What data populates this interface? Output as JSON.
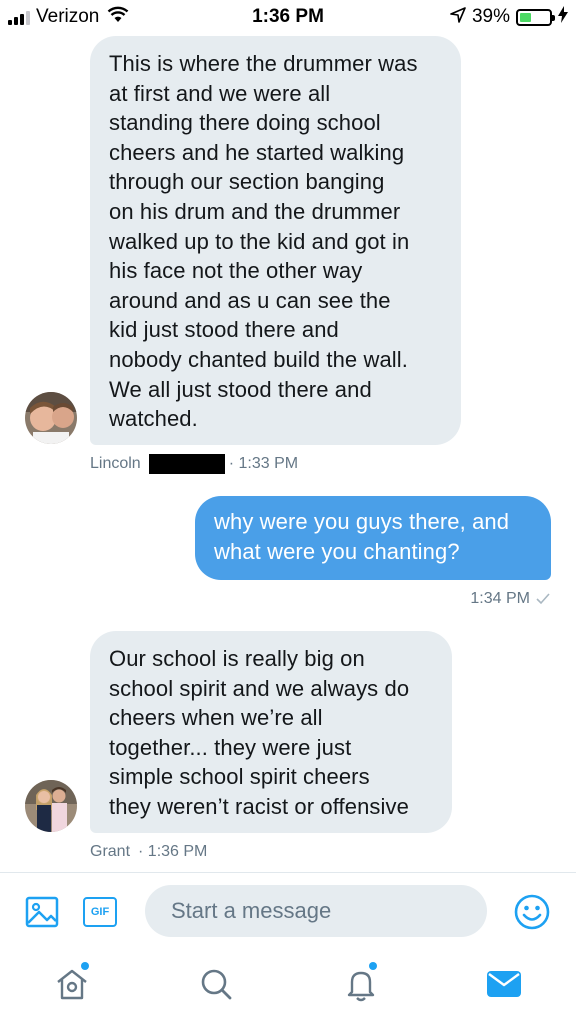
{
  "status_bar": {
    "carrier": "Verizon",
    "time": "1:36 PM",
    "battery_percent": "39%",
    "battery_level": 0.39,
    "icons": [
      "signal-icon",
      "wifi-icon",
      "location-icon",
      "battery-icon",
      "charging-icon"
    ]
  },
  "messages": [
    {
      "direction": "incoming",
      "lines": [
        "This is where the drummer was",
        "at first and we were all",
        "standing there doing school",
        "cheers and he started walking",
        "through our section banging",
        "on his drum and the drummer",
        "walked up to the kid and got in",
        "his face not the other way",
        "around and as u can see the",
        "kid just stood there and",
        "nobody chanted build the wall.",
        "We all just stood there and",
        "watched."
      ],
      "sender": "Lincoln",
      "time": "· 1:33 PM"
    },
    {
      "direction": "outgoing",
      "lines": [
        "why were you guys there, and",
        "what were you chanting?"
      ],
      "time": "1:34 PM"
    },
    {
      "direction": "incoming",
      "lines": [
        "Our school is really big on",
        "school spirit and we always do",
        "cheers when we’re all",
        "together... they were just",
        "simple school spirit cheers",
        "they weren’t racist or offensive"
      ],
      "sender": "Grant",
      "time": "· 1:36 PM"
    }
  ],
  "composer": {
    "gif_label": "GIF",
    "placeholder": "Start a message",
    "icons": [
      "image-icon",
      "gif-icon",
      "emoji-icon"
    ]
  },
  "tab_bar": {
    "tabs": [
      "home",
      "search",
      "notifications",
      "messages"
    ],
    "active": "messages"
  },
  "colors": {
    "accent": "#1da1f2",
    "outgoing_bubble": "#4a9fe8",
    "incoming_bubble": "#e6ecf0",
    "meta_text": "#657786"
  }
}
